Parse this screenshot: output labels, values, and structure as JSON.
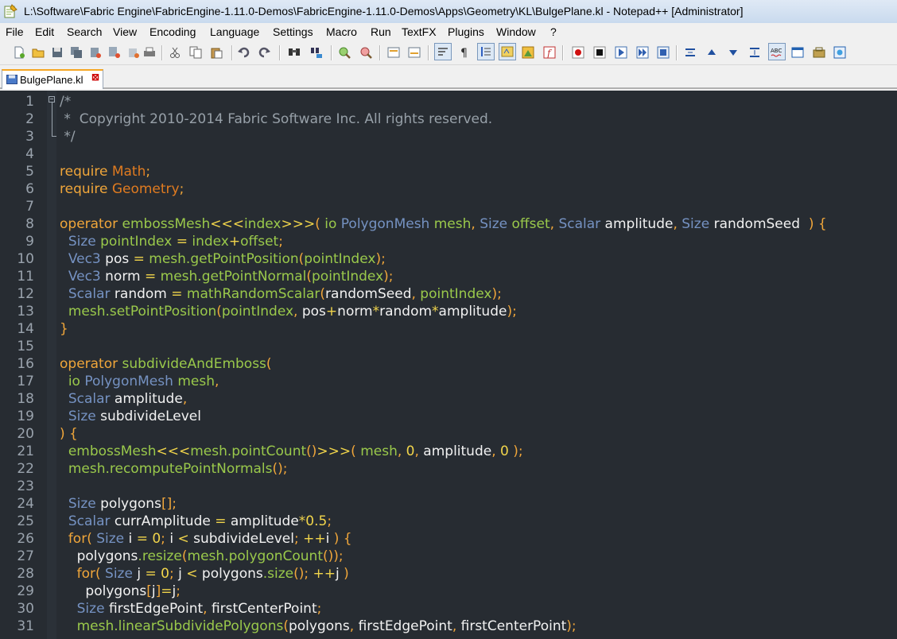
{
  "window": {
    "title": "L:\\Software\\Fabric Engine\\FabricEngine-1.11.0-Demos\\FabricEngine-1.11.0-Demos\\Apps\\Geometry\\KL\\BulgePlane.kl - Notepad++ [Administrator]"
  },
  "menu": {
    "items": [
      "File",
      "Edit",
      "Search",
      "View",
      "Encoding",
      "Language",
      "Settings",
      "Macro",
      "Run",
      "TextFX",
      "Plugins",
      "Window",
      "?"
    ]
  },
  "toolbar": {
    "buttons": [
      "new-file",
      "open-file",
      "save",
      "save-all",
      "close",
      "close-all",
      "print",
      "cut",
      "copy",
      "paste",
      "undo",
      "redo",
      "find",
      "replace",
      "zoom-in",
      "zoom-out",
      "sync-vertical",
      "sync-horizontal",
      "word-wrap",
      "show-all-chars",
      "indent-guide",
      "user-defined-language",
      "document-map",
      "function-list",
      "record-macro",
      "stop-macro",
      "play-macro",
      "run-macro-multiple",
      "save-macro",
      "text-fx-1",
      "text-fx-2",
      "text-fx-3",
      "text-fx-4",
      "spell-check",
      "plugin-1",
      "plugin-2",
      "plugin-3"
    ]
  },
  "tabs": [
    {
      "label": "BulgePlane.kl",
      "active": true
    }
  ],
  "editor": {
    "colors": {
      "background": "#272c32",
      "comment": "#97a0a8",
      "keyword": "#f0a63a",
      "type": "#7592c2",
      "identifier": "#9ac94b",
      "text": "#f2f2f2",
      "number": "#f1d54b"
    },
    "lines": [
      {
        "n": "1",
        "tokens": [
          [
            "c",
            "/*"
          ]
        ]
      },
      {
        "n": "2",
        "tokens": [
          [
            "c",
            " *  Copyright 2010-2014 Fabric Software Inc. All rights reserved."
          ]
        ]
      },
      {
        "n": "3",
        "tokens": [
          [
            "c",
            " */"
          ]
        ]
      },
      {
        "n": "4",
        "tokens": []
      },
      {
        "n": "5",
        "tokens": [
          [
            "k",
            "require "
          ],
          [
            "m",
            "Math"
          ],
          [
            "k",
            ";"
          ]
        ]
      },
      {
        "n": "6",
        "tokens": [
          [
            "k",
            "require "
          ],
          [
            "m",
            "Geometry"
          ],
          [
            "k",
            ";"
          ]
        ]
      },
      {
        "n": "7",
        "tokens": []
      },
      {
        "n": "8",
        "tokens": [
          [
            "k",
            "operator "
          ],
          [
            "i",
            "embossMesh"
          ],
          [
            "o",
            "<<<"
          ],
          [
            "i",
            "index"
          ],
          [
            "o",
            ">>>"
          ],
          [
            "k",
            "( "
          ],
          [
            "i",
            "io "
          ],
          [
            "t",
            "PolygonMesh "
          ],
          [
            "i",
            "mesh"
          ],
          [
            "k",
            ", "
          ],
          [
            "t",
            "Size "
          ],
          [
            "i",
            "offset"
          ],
          [
            "k",
            ", "
          ],
          [
            "t",
            "Scalar "
          ],
          [
            "x",
            "amplitude"
          ],
          [
            "k",
            ", "
          ],
          [
            "t",
            "Size "
          ],
          [
            "x",
            "randomSeed  "
          ],
          [
            "k",
            ") {"
          ]
        ]
      },
      {
        "n": "9",
        "tokens": [
          [
            "x",
            "  "
          ],
          [
            "t",
            "Size "
          ],
          [
            "i",
            "pointIndex "
          ],
          [
            "o",
            "= "
          ],
          [
            "i",
            "index"
          ],
          [
            "o",
            "+"
          ],
          [
            "i",
            "offset"
          ],
          [
            "k",
            ";"
          ]
        ]
      },
      {
        "n": "10",
        "tokens": [
          [
            "x",
            "  "
          ],
          [
            "t",
            "Vec3 "
          ],
          [
            "x",
            "pos "
          ],
          [
            "o",
            "= "
          ],
          [
            "i",
            "mesh.getPointPosition"
          ],
          [
            "k",
            "("
          ],
          [
            "i",
            "pointIndex"
          ],
          [
            "k",
            ");"
          ]
        ]
      },
      {
        "n": "11",
        "tokens": [
          [
            "x",
            "  "
          ],
          [
            "t",
            "Vec3 "
          ],
          [
            "x",
            "norm "
          ],
          [
            "o",
            "= "
          ],
          [
            "i",
            "mesh.getPointNormal"
          ],
          [
            "k",
            "("
          ],
          [
            "i",
            "pointIndex"
          ],
          [
            "k",
            ");"
          ]
        ]
      },
      {
        "n": "12",
        "tokens": [
          [
            "x",
            "  "
          ],
          [
            "t",
            "Scalar "
          ],
          [
            "x",
            "random "
          ],
          [
            "o",
            "= "
          ],
          [
            "i",
            "mathRandomScalar"
          ],
          [
            "k",
            "("
          ],
          [
            "x",
            "randomSeed"
          ],
          [
            "k",
            ", "
          ],
          [
            "i",
            "pointIndex"
          ],
          [
            "k",
            ");"
          ]
        ]
      },
      {
        "n": "13",
        "tokens": [
          [
            "x",
            "  "
          ],
          [
            "i",
            "mesh.setPointPosition"
          ],
          [
            "k",
            "("
          ],
          [
            "i",
            "pointIndex"
          ],
          [
            "k",
            ", "
          ],
          [
            "x",
            "pos"
          ],
          [
            "o",
            "+"
          ],
          [
            "x",
            "norm"
          ],
          [
            "o",
            "*"
          ],
          [
            "x",
            "random"
          ],
          [
            "o",
            "*"
          ],
          [
            "x",
            "amplitude"
          ],
          [
            "k",
            ");"
          ]
        ]
      },
      {
        "n": "14",
        "tokens": [
          [
            "k",
            "}"
          ]
        ]
      },
      {
        "n": "15",
        "tokens": []
      },
      {
        "n": "16",
        "tokens": [
          [
            "k",
            "operator "
          ],
          [
            "i",
            "subdivideAndEmboss"
          ],
          [
            "k",
            "("
          ]
        ]
      },
      {
        "n": "17",
        "tokens": [
          [
            "x",
            "  "
          ],
          [
            "i",
            "io "
          ],
          [
            "t",
            "PolygonMesh "
          ],
          [
            "i",
            "mesh"
          ],
          [
            "k",
            ","
          ]
        ]
      },
      {
        "n": "18",
        "tokens": [
          [
            "x",
            "  "
          ],
          [
            "t",
            "Scalar "
          ],
          [
            "x",
            "amplitude"
          ],
          [
            "k",
            ","
          ]
        ]
      },
      {
        "n": "19",
        "tokens": [
          [
            "x",
            "  "
          ],
          [
            "t",
            "Size "
          ],
          [
            "x",
            "subdivideLevel"
          ]
        ]
      },
      {
        "n": "20",
        "tokens": [
          [
            "k",
            ") {"
          ]
        ]
      },
      {
        "n": "21",
        "tokens": [
          [
            "x",
            "  "
          ],
          [
            "i",
            "embossMesh"
          ],
          [
            "o",
            "<<<"
          ],
          [
            "i",
            "mesh.pointCount"
          ],
          [
            "k",
            "()"
          ],
          [
            "o",
            ">>>"
          ],
          [
            "k",
            "( "
          ],
          [
            "i",
            "mesh"
          ],
          [
            "k",
            ", "
          ],
          [
            "n",
            "0"
          ],
          [
            "k",
            ", "
          ],
          [
            "x",
            "amplitude"
          ],
          [
            "k",
            ", "
          ],
          [
            "n",
            "0 "
          ],
          [
            "k",
            ");"
          ]
        ]
      },
      {
        "n": "22",
        "tokens": [
          [
            "x",
            "  "
          ],
          [
            "i",
            "mesh.recomputePointNormals"
          ],
          [
            "k",
            "();"
          ]
        ]
      },
      {
        "n": "23",
        "tokens": []
      },
      {
        "n": "24",
        "tokens": [
          [
            "x",
            "  "
          ],
          [
            "t",
            "Size "
          ],
          [
            "x",
            "polygons"
          ],
          [
            "k",
            "[];"
          ]
        ]
      },
      {
        "n": "25",
        "tokens": [
          [
            "x",
            "  "
          ],
          [
            "t",
            "Scalar "
          ],
          [
            "x",
            "currAmplitude "
          ],
          [
            "o",
            "= "
          ],
          [
            "x",
            "amplitude"
          ],
          [
            "o",
            "*"
          ],
          [
            "n",
            "0.5"
          ],
          [
            "k",
            ";"
          ]
        ]
      },
      {
        "n": "26",
        "tokens": [
          [
            "x",
            "  "
          ],
          [
            "k",
            "for( "
          ],
          [
            "t",
            "Size "
          ],
          [
            "x",
            "i "
          ],
          [
            "o",
            "= "
          ],
          [
            "n",
            "0"
          ],
          [
            "k",
            "; "
          ],
          [
            "x",
            "i "
          ],
          [
            "o",
            "< "
          ],
          [
            "x",
            "subdivideLevel"
          ],
          [
            "k",
            "; "
          ],
          [
            "o",
            "++"
          ],
          [
            "x",
            "i "
          ],
          [
            "k",
            ") {"
          ]
        ]
      },
      {
        "n": "27",
        "tokens": [
          [
            "x",
            "    polygons"
          ],
          [
            "i",
            ".resize"
          ],
          [
            "k",
            "("
          ],
          [
            "i",
            "mesh.polygonCount"
          ],
          [
            "k",
            "());"
          ]
        ]
      },
      {
        "n": "28",
        "tokens": [
          [
            "x",
            "    "
          ],
          [
            "k",
            "for( "
          ],
          [
            "t",
            "Size "
          ],
          [
            "x",
            "j "
          ],
          [
            "o",
            "= "
          ],
          [
            "n",
            "0"
          ],
          [
            "k",
            "; "
          ],
          [
            "x",
            "j "
          ],
          [
            "o",
            "< "
          ],
          [
            "x",
            "polygons"
          ],
          [
            "i",
            ".size"
          ],
          [
            "k",
            "(); "
          ],
          [
            "o",
            "++"
          ],
          [
            "x",
            "j "
          ],
          [
            "k",
            ")"
          ]
        ]
      },
      {
        "n": "29",
        "tokens": [
          [
            "x",
            "      polygons"
          ],
          [
            "k",
            "["
          ],
          [
            "x",
            "j"
          ],
          [
            "k",
            "]"
          ],
          [
            "o",
            "="
          ],
          [
            "x",
            "j"
          ],
          [
            "k",
            ";"
          ]
        ]
      },
      {
        "n": "30",
        "tokens": [
          [
            "x",
            "    "
          ],
          [
            "t",
            "Size "
          ],
          [
            "x",
            "firstEdgePoint"
          ],
          [
            "k",
            ", "
          ],
          [
            "x",
            "firstCenterPoint"
          ],
          [
            "k",
            ";"
          ]
        ]
      },
      {
        "n": "31",
        "tokens": [
          [
            "x",
            "    "
          ],
          [
            "i",
            "mesh.linearSubdividePolygons"
          ],
          [
            "k",
            "("
          ],
          [
            "x",
            "polygons"
          ],
          [
            "k",
            ", "
          ],
          [
            "x",
            "firstEdgePoint"
          ],
          [
            "k",
            ", "
          ],
          [
            "x",
            "firstCenterPoint"
          ],
          [
            "k",
            ");"
          ]
        ]
      }
    ]
  }
}
